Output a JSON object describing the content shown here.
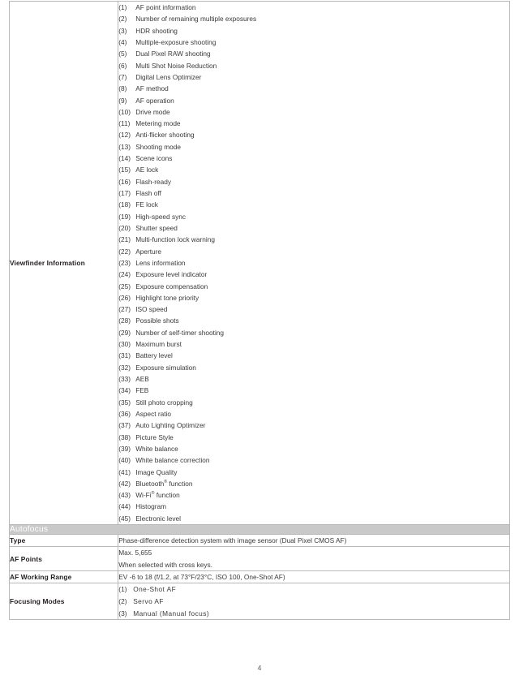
{
  "document": {
    "page_number": "4",
    "colors": {
      "section_band": "#c9c9c9",
      "section_text": "#ffffff",
      "border": "#b9b9b9",
      "body_text": "#3a3a3a",
      "label_text": "#231f20"
    }
  },
  "viewfinder_row": {
    "label": "Viewfinder Information",
    "items": [
      {
        "num": "(1)",
        "text": "AF point information"
      },
      {
        "num": "(2)",
        "text": "Number of remaining multiple exposures"
      },
      {
        "num": "(3)",
        "text": "HDR shooting"
      },
      {
        "num": "(4)",
        "text": "Multiple-exposure shooting"
      },
      {
        "num": "(5)",
        "text": "Dual Pixel RAW shooting"
      },
      {
        "num": "(6)",
        "text": "Multi Shot Noise Reduction"
      },
      {
        "num": "(7)",
        "text": "Digital Lens Optimizer"
      },
      {
        "num": "(8)",
        "text": "AF method"
      },
      {
        "num": "(9)",
        "text": "AF operation"
      },
      {
        "num": "(10)",
        "text": "Drive mode"
      },
      {
        "num": "(11)",
        "text": "Metering mode"
      },
      {
        "num": "(12)",
        "text": "Anti-flicker shooting"
      },
      {
        "num": "(13)",
        "text": "Shooting mode"
      },
      {
        "num": "(14)",
        "text": "Scene icons"
      },
      {
        "num": "(15)",
        "text": "AE lock"
      },
      {
        "num": "(16)",
        "text": "Flash-ready"
      },
      {
        "num": "(17)",
        "text": "Flash off"
      },
      {
        "num": "(18)",
        "text": "FE lock"
      },
      {
        "num": "(19)",
        "text": "High-speed sync"
      },
      {
        "num": "(20)",
        "text": "Shutter speed"
      },
      {
        "num": "(21)",
        "text": "Multi-function lock warning"
      },
      {
        "num": "(22)",
        "text": "Aperture"
      },
      {
        "num": "(23)",
        "text": "Lens information"
      },
      {
        "num": "(24)",
        "text": "Exposure level indicator"
      },
      {
        "num": "(25)",
        "text": "Exposure compensation"
      },
      {
        "num": "(26)",
        "text": "Highlight tone priority"
      },
      {
        "num": "(27)",
        "text": "ISO speed"
      },
      {
        "num": "(28)",
        "text": "Possible shots"
      },
      {
        "num": "(29)",
        "text": "Number of self-timer shooting"
      },
      {
        "num": "(30)",
        "text": "Maximum burst"
      },
      {
        "num": "(31)",
        "text": "Battery level"
      },
      {
        "num": "(32)",
        "text": "Exposure simulation"
      },
      {
        "num": "(33)",
        "text": "AEB"
      },
      {
        "num": "(34)",
        "text": "FEB"
      },
      {
        "num": "(35)",
        "text": "Still photo cropping"
      },
      {
        "num": "(36)",
        "text": "Aspect ratio"
      },
      {
        "num": "(37)",
        "text": "Auto Lighting Optimizer"
      },
      {
        "num": "(38)",
        "text": "Picture Style"
      },
      {
        "num": "(39)",
        "text": "White balance"
      },
      {
        "num": "(40)",
        "text": "White balance correction"
      },
      {
        "num": "(41)",
        "text": "Image Quality"
      },
      {
        "num": "(42)",
        "text": "Bluetooth",
        "sup": "®",
        "text_after": " function"
      },
      {
        "num": "(43)",
        "text": "Wi-Fi",
        "sup": "®",
        "text_after": " function"
      },
      {
        "num": "(44)",
        "text": "Histogram"
      },
      {
        "num": "(45)",
        "text": "Electronic level"
      }
    ]
  },
  "autofocus_section": {
    "header": "Autofocus",
    "rows": {
      "type": {
        "label": "Type",
        "value": "Phase-difference detection system with image sensor (Dual Pixel CMOS AF)"
      },
      "af_points": {
        "label": "AF Points",
        "line1": "Max. 5,655",
        "line2": "When selected with cross keys."
      },
      "af_working_range": {
        "label": "AF Working Range",
        "value": "EV -6 to 18 (f/1.2, at 73°F/23°C, ISO 100, One-Shot AF)"
      },
      "focusing_modes": {
        "label": "Focusing Modes",
        "items": [
          {
            "num": "(1)",
            "text": "One-Shot AF"
          },
          {
            "num": "(2)",
            "text": "Servo AF"
          },
          {
            "num": "(3)",
            "text": "Manual (Manual focus)"
          }
        ]
      }
    }
  }
}
